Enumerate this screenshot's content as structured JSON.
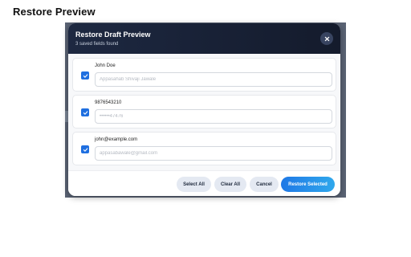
{
  "page": {
    "heading": "Restore Preview"
  },
  "modal": {
    "title": "Restore Draft Preview",
    "subtitle": "3 saved fields found",
    "close_icon": "close-icon"
  },
  "fields": [
    {
      "label": "John Doe",
      "placeholder": "Appasahab Shivaji Jawale",
      "checked": true
    },
    {
      "label": "9876543210",
      "placeholder": "••••••47476",
      "checked": true
    },
    {
      "label": "john@example.com",
      "placeholder": "appasabawale@gmail.com",
      "checked": true
    }
  ],
  "footer": {
    "select_all": "Select All",
    "clear_all": "Clear All",
    "cancel": "Cancel",
    "restore_selected": "Restore Selected"
  },
  "colors": {
    "header_bg": "#1d2841",
    "checkbox": "#1f6fe0",
    "primary_button": "#1f78e6",
    "secondary_button": "#e4e9f2"
  }
}
